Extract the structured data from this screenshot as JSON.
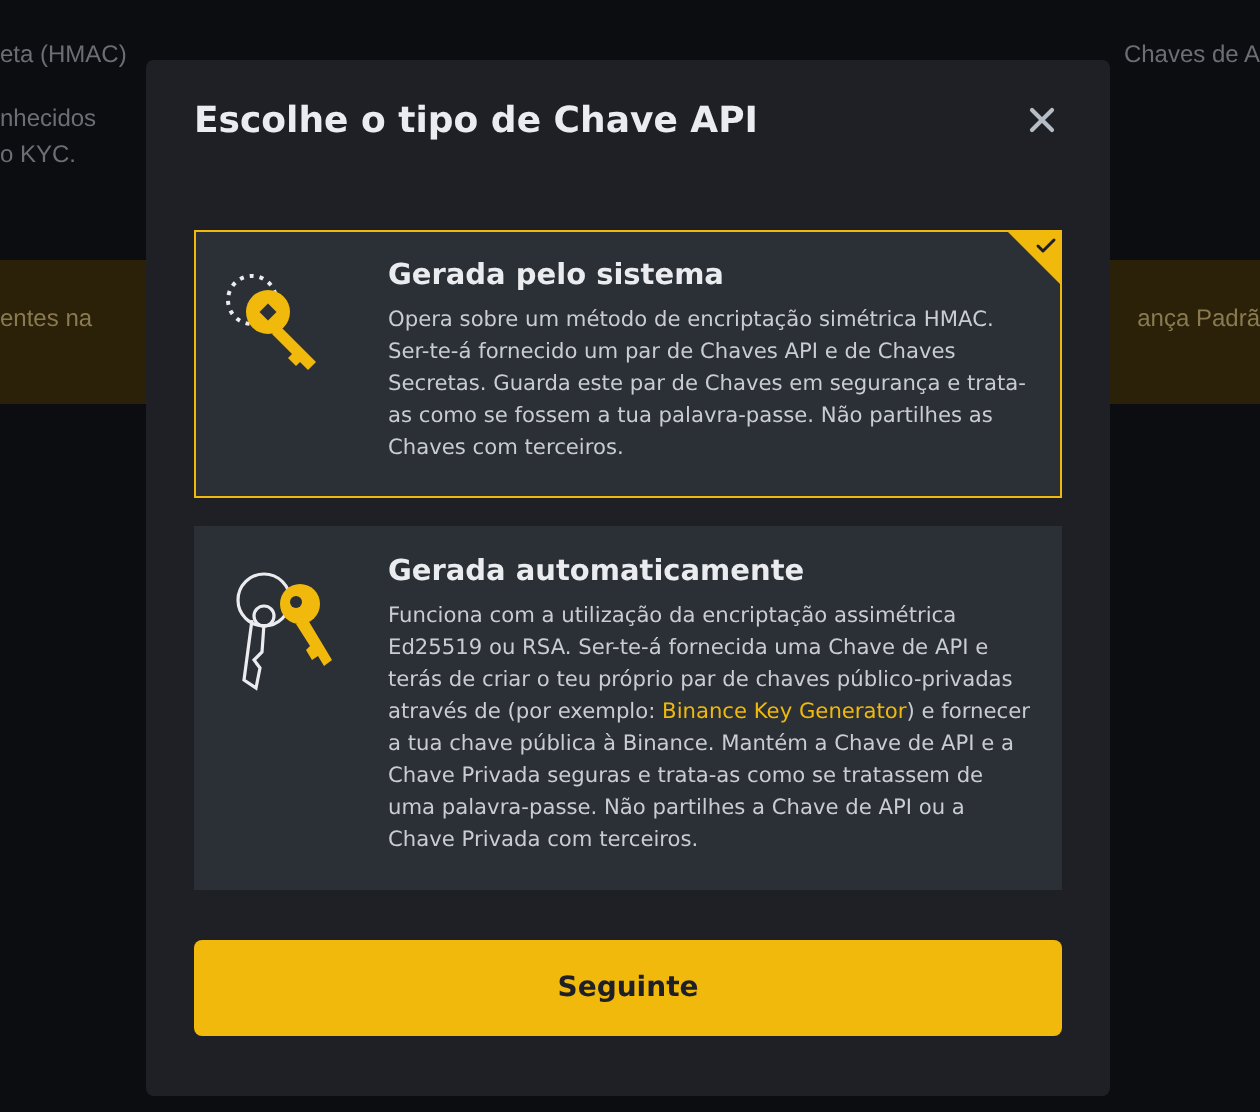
{
  "background": {
    "lines": [
      {
        "left": "eta (HMAC)",
        "right": "Chaves de A"
      },
      {
        "left": "nhecidos"
      },
      {
        "left": "o KYC."
      }
    ],
    "banner": {
      "left": "entes na",
      "right": "ança Padrã"
    }
  },
  "dialog": {
    "title": "Escolhe o tipo de Chave API",
    "options": [
      {
        "kind": "system",
        "selected": true,
        "title": "Gerada pelo sistema",
        "description": "Opera sobre um método de encriptação simétrica HMAC. Ser-te-á fornecido um par de Chaves API e de Chaves Secretas. Guarda este par de Chaves em segurança e trata-as como se fossem a tua palavra-passe. Não partilhes as Chaves com terceiros."
      },
      {
        "kind": "self",
        "selected": false,
        "title": "Gerada automaticamente",
        "description": "Funciona com a utilização da encriptação assimétrica Ed25519 ou RSA. Ser-te-á fornecida uma Chave de API e terás de criar o teu próprio par de chaves público-privadas através de (por exemplo: ",
        "link": "Binance Key Generator",
        "description_after": ") e fornecer a tua chave pública à Binance. Mantém a Chave de API e a Chave Privada seguras e trata-as como se tratassem de uma palavra-passe. Não partilhes a Chave de API ou a Chave Privada com terceiros."
      }
    ],
    "button": "Seguinte"
  }
}
